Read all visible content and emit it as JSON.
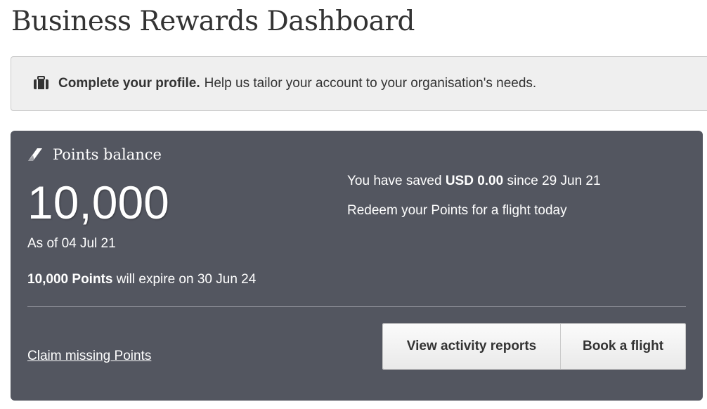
{
  "page": {
    "title": "Business Rewards Dashboard"
  },
  "banner": {
    "icon": "briefcase-icon",
    "bold_text": "Complete your profile.",
    "text": "Help us tailor your account to your organisation's needs."
  },
  "points_card": {
    "icon": "airline-tail-icon",
    "title": "Points balance",
    "balance": "10,000",
    "as_of": "As of 04 Jul 21",
    "expiry_points": "10,000 Points",
    "expiry_text": "will expire on 30 Jun 24",
    "savings_prefix": "You have saved",
    "savings_amount": "USD 0.00",
    "savings_suffix": "since 29 Jun 21",
    "redeem_text": "Redeem your Points for a flight today",
    "claim_link": "Claim missing Points",
    "view_reports_label": "View activity reports",
    "book_flight_label": "Book a flight"
  },
  "colors": {
    "card_background": "#535660",
    "banner_background": "#efefef",
    "button_background": "#f2f2f2",
    "text_dark": "#333333"
  }
}
